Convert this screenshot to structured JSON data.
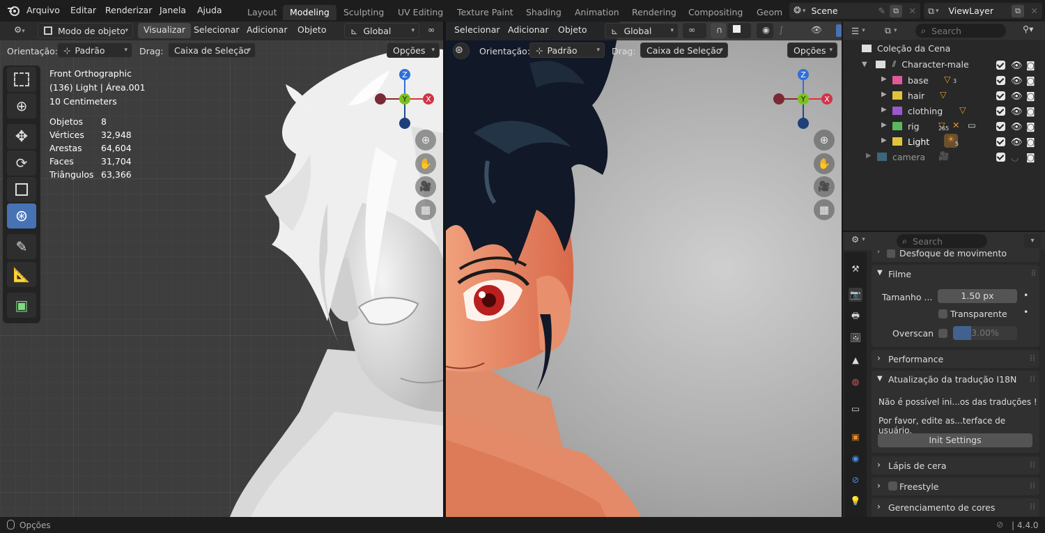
{
  "topbar": {
    "menu": [
      "Arquivo",
      "Editar",
      "Renderizar",
      "Janela",
      "Ajuda"
    ],
    "workspaces": [
      "Layout",
      "Modeling",
      "Sculpting",
      "UV Editing",
      "Texture Paint",
      "Shading",
      "Animation",
      "Rendering",
      "Compositing",
      "Geom"
    ],
    "active_workspace": "Modeling",
    "scene": "Scene",
    "view_layer": "ViewLayer"
  },
  "left_header": {
    "mode": "Modo de objeto",
    "menus": [
      "Visualizar",
      "Selecionar",
      "Adicionar",
      "Objeto"
    ],
    "transform": "Global",
    "orientation_label": "Orientação:",
    "orientation_value": "Padrão",
    "drag_label": "Drag:",
    "drag_value": "Caixa de Seleção",
    "options": "Opções"
  },
  "right_header": {
    "menus": [
      "Selecionar",
      "Adicionar",
      "Objeto"
    ],
    "transform": "Global",
    "orientation_label": "Orientação:",
    "orientation_value": "Padrão",
    "drag_label": "Drag:",
    "drag_value": "Caixa de Seleção",
    "options": "Opções"
  },
  "overlay": {
    "view": "Front Orthographic",
    "context": "(136) Light | Área.001",
    "scale": "10 Centimeters",
    "stats": [
      {
        "label": "Objetos",
        "value": "8"
      },
      {
        "label": "Vértices",
        "value": "32,948"
      },
      {
        "label": "Arestas",
        "value": "64,604"
      },
      {
        "label": "Faces",
        "value": "31,704"
      },
      {
        "label": "Triângulos",
        "value": "63,366"
      }
    ]
  },
  "gizmo": {
    "z": "Z",
    "y": "Y",
    "x": "X"
  },
  "outliner": {
    "search_placeholder": "Search",
    "root": "Coleção da Cena",
    "collection": "Character-male",
    "items": [
      {
        "name": "base",
        "color": "#e05a9a",
        "badge": "3"
      },
      {
        "name": "hair",
        "color": "#e0c33a",
        "badge": ""
      },
      {
        "name": "clothing",
        "color": "#9b59d0",
        "badge": ""
      },
      {
        "name": "rig",
        "color": "#5cb85c",
        "badge": "265"
      },
      {
        "name": "Light",
        "color": "#e0c33a",
        "badge": "5"
      }
    ],
    "camera": "camera"
  },
  "properties": {
    "search_placeholder": "Search",
    "motion_blur": "Desfoque de movimento",
    "film": "Filme",
    "filter_size_label": "Tamanho ...",
    "filter_size_value": "1.50 px",
    "transparent": "Transparente",
    "overscan_label": "Overscan",
    "overscan_value": "3.00%",
    "performance": "Performance",
    "i18n_title": "Atualização da tradução I18N",
    "i18n_line1": "Não é possível ini...os das traduções !",
    "i18n_line2": "Por favor, edite as...terface de usuário.",
    "init_settings": "Init Settings",
    "grease_pencil": "Lápis de cera",
    "freestyle": "Freestyle",
    "color_management": "Gerenciamento de cores"
  },
  "statusbar": {
    "options": "Opções",
    "version": "4.4.0"
  }
}
